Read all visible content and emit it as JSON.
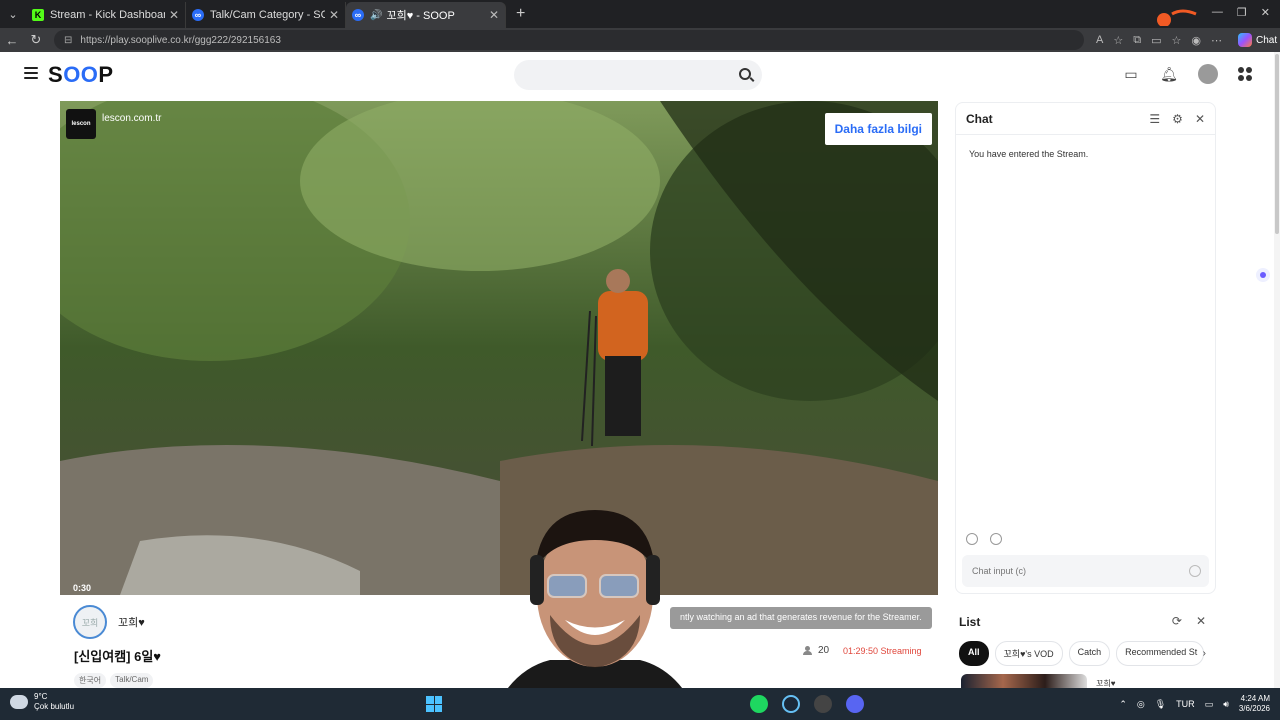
{
  "browser": {
    "tabs": [
      {
        "title": "Stream - Kick Dashboard",
        "icon": "kick-icon",
        "active": false
      },
      {
        "title": "Talk/Cam Category - SOOP",
        "icon": "soop-icon",
        "active": false
      },
      {
        "title": "꼬희♥ - SOOP",
        "icon": "soop-icon",
        "active": true
      }
    ],
    "url": "https://play.sooplive.co.kr/ggg222/292156163",
    "chat_button": "Chat"
  },
  "site": {
    "logo": "SOOP",
    "search_placeholder": ""
  },
  "player": {
    "ad_domain": "lescon.com.tr",
    "ad_logo_text": "lescon",
    "more_info_label": "Daha fazla bilgi",
    "ad_time": "0:30",
    "ad_note": "ntly watching an ad that generates revenue for the Streamer."
  },
  "stream": {
    "streamer_name": "꼬희♥",
    "avatar_text": "꼬희",
    "title": "[신입여캠] 6일♥",
    "tags": [
      "한국어",
      "Talk/Cam"
    ],
    "viewers": "20",
    "elapsed": "01:29:50 Streaming"
  },
  "chat": {
    "title": "Chat",
    "system_message": "You have entered the Stream.",
    "input_placeholder": "Chat input (c)"
  },
  "list": {
    "title": "List",
    "tabs": [
      "All",
      "꼬희♥'s VOD",
      "Catch",
      "Recommended St"
    ],
    "first_item_name": "꼬희♥"
  },
  "taskbar": {
    "temperature": "9°C",
    "weather": "Çok bulutlu",
    "language": "TUR",
    "time": "4:24 AM",
    "date": "3/6/2026"
  }
}
